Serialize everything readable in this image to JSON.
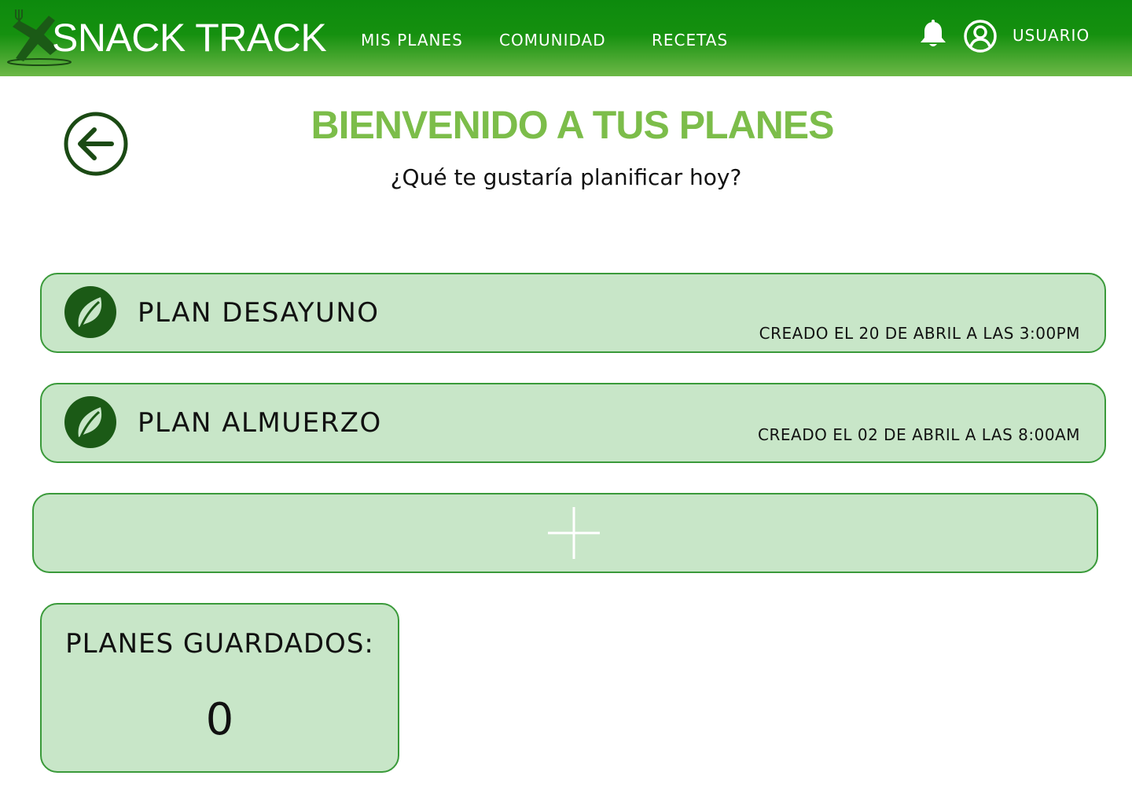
{
  "header": {
    "brand": "SNACK TRACK",
    "nav": [
      {
        "label": "MIS PLANES"
      },
      {
        "label": "COMUNIDAD"
      },
      {
        "label": "RECETAS"
      }
    ],
    "user_label": "USUARIO"
  },
  "main": {
    "title": "BIENVENIDO A TUS PLANES",
    "subtitle": "¿Qué te gustaría planificar hoy?",
    "plans": [
      {
        "title": "PLAN DESAYUNO",
        "created": "CREADO EL 20 DE ABRIL A LAS 3:00PM",
        "icon": "leaf-icon"
      },
      {
        "title": "PLAN ALMUERZO",
        "created": "CREADO EL 02 DE ABRIL A LAS 8:00AM",
        "icon": "leaf-icon"
      }
    ],
    "add_icon": "plus-icon",
    "saved": {
      "label": "PLANES GUARDADOS:",
      "count": "0"
    }
  },
  "colors": {
    "header_top": "#0d8a0d",
    "header_bottom": "#6db847",
    "title_green": "#7cbd4a",
    "card_fill": "#c8e6c8",
    "card_border": "#3a9a3a",
    "icon_dark": "#1b5a16"
  }
}
